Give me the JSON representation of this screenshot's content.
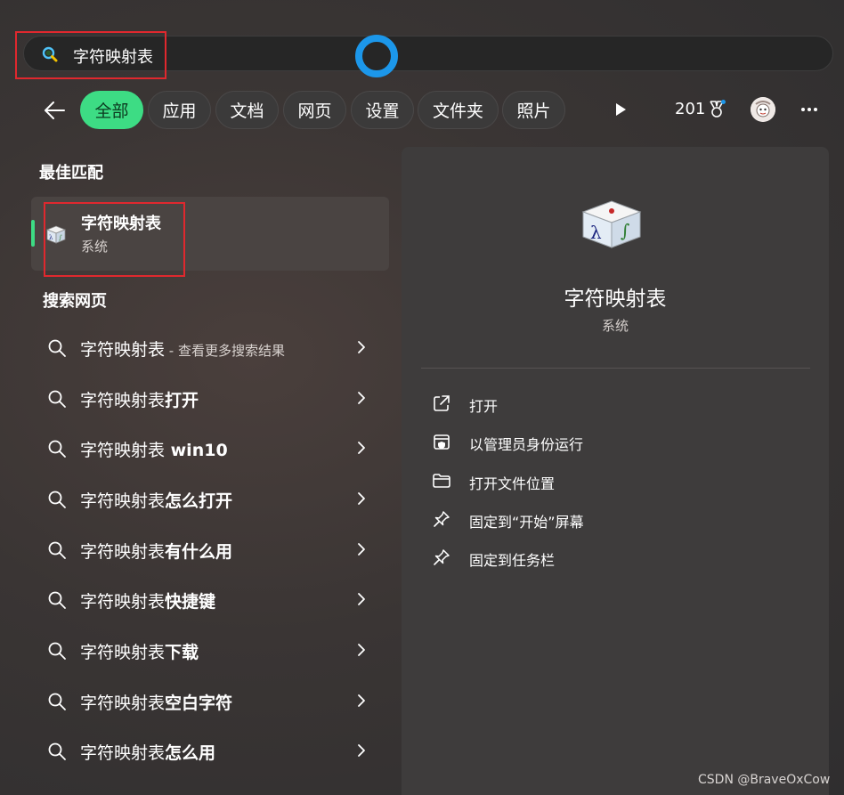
{
  "search": {
    "query": "字符映射表"
  },
  "filters": {
    "tabs": [
      {
        "label": "全部",
        "active": true
      },
      {
        "label": "应用"
      },
      {
        "label": "文档"
      },
      {
        "label": "网页"
      },
      {
        "label": "设置"
      },
      {
        "label": "文件夹"
      },
      {
        "label": "照片"
      }
    ],
    "points": "201"
  },
  "best_match": {
    "heading": "最佳匹配",
    "title": "字符映射表",
    "subtitle": "系统"
  },
  "web_search": {
    "heading": "搜索网页",
    "items": [
      {
        "prefix": "字符映射表",
        "suffix": "",
        "note": " - 查看更多搜索结果"
      },
      {
        "prefix": "字符映射表",
        "suffix": "打开",
        "note": ""
      },
      {
        "prefix": "字符映射表",
        "suffix": " win10",
        "note": ""
      },
      {
        "prefix": "字符映射表",
        "suffix": "怎么打开",
        "note": ""
      },
      {
        "prefix": "字符映射表",
        "suffix": "有什么用",
        "note": ""
      },
      {
        "prefix": "字符映射表",
        "suffix": "快捷键",
        "note": ""
      },
      {
        "prefix": "字符映射表",
        "suffix": "下载",
        "note": ""
      },
      {
        "prefix": "字符映射表",
        "suffix": "空白字符",
        "note": ""
      },
      {
        "prefix": "字符映射表",
        "suffix": "怎么用",
        "note": ""
      }
    ]
  },
  "detail": {
    "app_name": "字符映射表",
    "app_category": "系统",
    "actions": [
      {
        "label": "打开",
        "icon": "open-external-icon"
      },
      {
        "label": "以管理员身份运行",
        "icon": "shield-admin-icon"
      },
      {
        "label": "打开文件位置",
        "icon": "folder-icon"
      },
      {
        "label": "固定到“开始”屏幕",
        "icon": "pin-icon"
      },
      {
        "label": "固定到任务栏",
        "icon": "pin-icon"
      }
    ]
  },
  "watermark": "CSDN @BraveOxCow",
  "colors": {
    "accent_green": "#3ddc84",
    "cortana_blue": "#1c97ea",
    "highlight_red": "#e0282e"
  }
}
